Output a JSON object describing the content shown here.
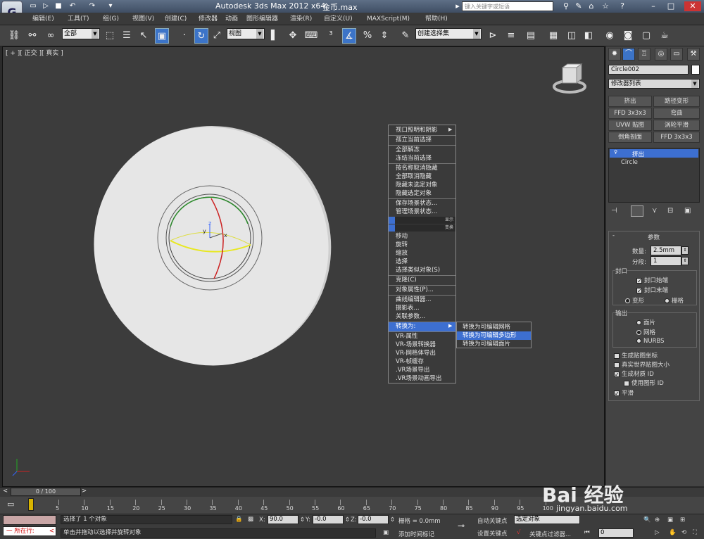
{
  "title": {
    "app": "Autodesk 3ds Max  2012 x64",
    "file": "金币.max",
    "search_placeholder": "键入关键字或短语",
    "app_icon": "3ds-max-logo"
  },
  "menu": [
    "编辑(E)",
    "工具(T)",
    "组(G)",
    "视图(V)",
    "创建(C)",
    "修改器",
    "动画",
    "图形编辑器",
    "渲染(R)",
    "自定义(U)",
    "MAXScript(M)",
    "帮助(H)"
  ],
  "toolbar": {
    "selection_filter": "全部",
    "ref_coord": "视图",
    "named_selection": "创建选择集"
  },
  "viewport": {
    "label": "[ + ][ 正交 ][ 真实 ]",
    "gizmo_labels": {
      "z": "z",
      "y": "y",
      "x": "x"
    }
  },
  "quad_menu": {
    "section1": [
      "视口照明和阴影",
      "孤立当前选择",
      "全部解冻",
      "冻结当前选择",
      "按名称取消隐藏",
      "全部取消隐藏",
      "隐藏未选定对象",
      "隐藏选定对象",
      "保存场景状态...",
      "管理场景状态..."
    ],
    "bar_display": "显示",
    "bar_transform": "变换",
    "section2": [
      "移动",
      "旋转",
      "缩放",
      "选择",
      "选择类似对象(S)",
      "克隆(C)",
      "对象属性(P)...",
      "曲线编辑器...",
      "摄影表...",
      "关联参数...",
      "转换为:",
      "VR-属性",
      "VR-场景转换器",
      "VR-网格体导出",
      "VR-帧缓存",
      ".VR场景导出",
      ".VR场景动画导出"
    ],
    "selected_item": "转换为:"
  },
  "submenu": {
    "items": [
      "转换为可编辑网格",
      "转换为可编辑多边形",
      "转换为可编辑面片"
    ],
    "selected": "转换为可编辑多边形"
  },
  "command_panel": {
    "object_name": "Circle002",
    "modifier_list": "修改器列表",
    "buttons": [
      "挤出",
      "路径变形",
      "FFD 3x3x3",
      "弯曲",
      "UVW 贴图",
      "涡轮平滑",
      "倒角剖面",
      "FFD 3x3x3"
    ],
    "stack": [
      "挤出",
      "Circle"
    ],
    "params_title": "参数",
    "amount_label": "数量:",
    "amount_value": "2.5mm",
    "segments_label": "分段:",
    "segments_value": "1",
    "capping_title": "封口",
    "cap_start": "封口始端",
    "cap_end": "封口末端",
    "morph": "变形",
    "grid": "栅格",
    "output_title": "输出",
    "patch": "面片",
    "mesh": "网格",
    "nurbs": "NURBS",
    "gen_map_coords": "生成贴图坐标",
    "real_world": "真实世界贴图大小",
    "gen_mat_ids": "生成材质 ID",
    "use_shape_ids": "使用图形 ID",
    "smooth": "平滑"
  },
  "timeline": {
    "slider": "0 / 100",
    "ticks": [
      "5",
      "10",
      "15",
      "20",
      "25",
      "30",
      "35",
      "40",
      "45",
      "50",
      "55",
      "60",
      "65",
      "70",
      "75",
      "80",
      "85",
      "90",
      "95",
      "100"
    ]
  },
  "status": {
    "maxscript_label": "所在行:",
    "selected_text": "选择了 1 个对象",
    "prompt_text": "单击并拖动以选择并旋转对象",
    "x_label": "X:",
    "x_value": "90.0",
    "y_label": "Y:",
    "y_value": "-0.0",
    "z_label": "Z:",
    "z_value": "-0.0",
    "grid": "栅格 = 0.0mm",
    "add_time_tag": "添加时间标记",
    "auto_key": "自动关键点",
    "set_key": "设置关键点",
    "selected_obj": "选定对象",
    "key_filter": "关键点过滤器...",
    "frame": "0"
  },
  "watermark": {
    "brand": "Bai 经验",
    "url": "jingyan.baidu.com"
  },
  "colors": {
    "highlight": "#3d6fd0",
    "viewport_bg": "#3c3c3c",
    "disc": "#e6e6e6"
  }
}
